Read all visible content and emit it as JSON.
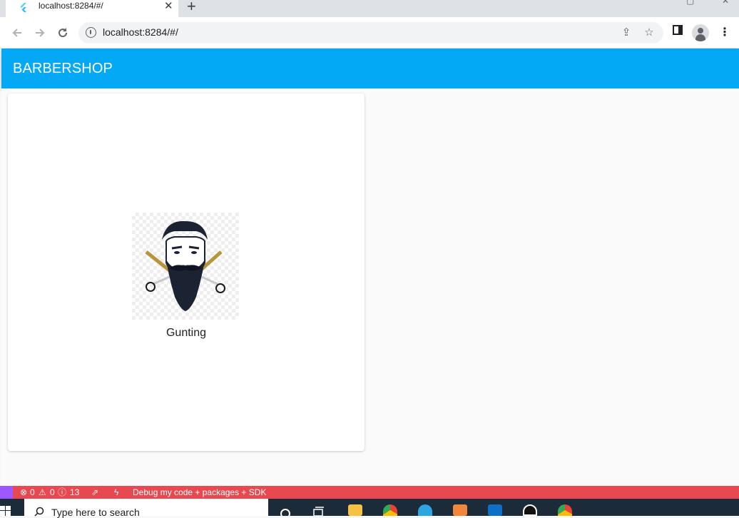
{
  "browser": {
    "tab_title": "localhost:8284/#/",
    "tab_close": "✕",
    "new_tab": "+",
    "url": "localhost:8284/#/"
  },
  "app": {
    "title": "BARBERSHOP",
    "accent_color": "#03a9f4",
    "items": [
      {
        "label": "Gunting",
        "image": "barber-logo"
      }
    ]
  },
  "status_bar": {
    "errors": "0",
    "warnings": "0",
    "infos": "13",
    "debug_label": "Debug my code + packages + SDK",
    "color": "#e8484f"
  },
  "taskbar": {
    "search_placeholder": "Type here to search"
  }
}
